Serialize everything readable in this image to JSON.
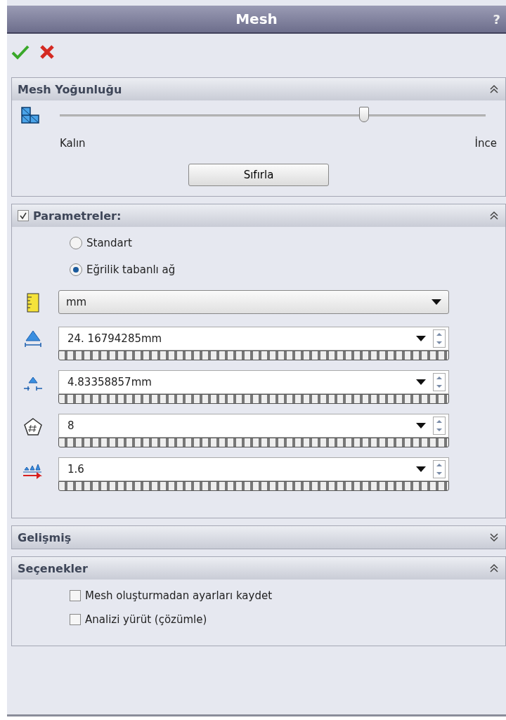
{
  "window": {
    "title": "Mesh",
    "help": "?"
  },
  "sections": [
    {
      "kind": "density",
      "title": "Mesh Yoğunluğu",
      "expanded": true,
      "slider": {
        "level": 0.715,
        "min_label": "Kalın",
        "max_label": "İnce"
      },
      "reset_button": "Sıfırla"
    },
    {
      "kind": "parameters",
      "title": "Parametreler:",
      "expanded": true,
      "checked": true,
      "radios": [
        {
          "label": "Standart",
          "selected": false
        },
        {
          "label": "Eğrilik tabanlı ağ",
          "selected": true
        }
      ],
      "rows": [
        {
          "kind": "dropdown",
          "value": "mm"
        },
        {
          "kind": "spin",
          "value": "24. 16794285mm"
        },
        {
          "kind": "spin",
          "value": "4.83358857mm"
        },
        {
          "kind": "spin",
          "value": "8"
        },
        {
          "kind": "spin",
          "value": "1.6"
        }
      ]
    },
    {
      "title": "Gelişmiş",
      "expanded": false
    },
    {
      "kind": "options",
      "title": "Seçenekler",
      "expanded": true,
      "checkboxes": [
        {
          "label": "Mesh oluşturmadan ayarları kaydet",
          "checked": false
        },
        {
          "label": "Analizi yürüt (çözümle)",
          "checked": false
        }
      ]
    }
  ]
}
